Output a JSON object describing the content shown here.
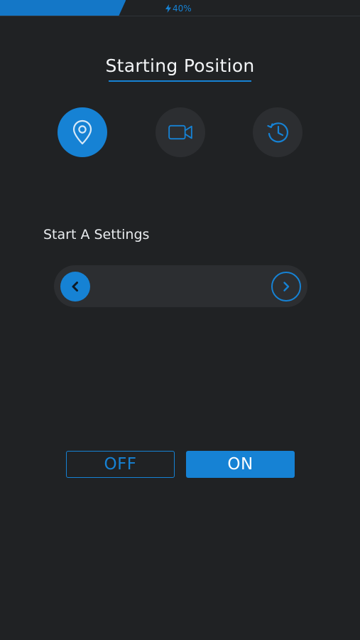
{
  "status_bar": {
    "progress_percent": 35,
    "battery_label": "40%"
  },
  "title": "Starting Position",
  "modes": [
    {
      "icon": "location-pin-icon",
      "active": true
    },
    {
      "icon": "video-camera-icon",
      "active": false
    },
    {
      "icon": "history-icon",
      "active": false
    }
  ],
  "settings": {
    "label": "Start A Settings",
    "value": ""
  },
  "toggle": {
    "off_label": "OFF",
    "on_label": "ON",
    "selected": "ON"
  },
  "colors": {
    "background": "#202224",
    "accent": "#1682d4",
    "surface": "#2c2e31"
  }
}
